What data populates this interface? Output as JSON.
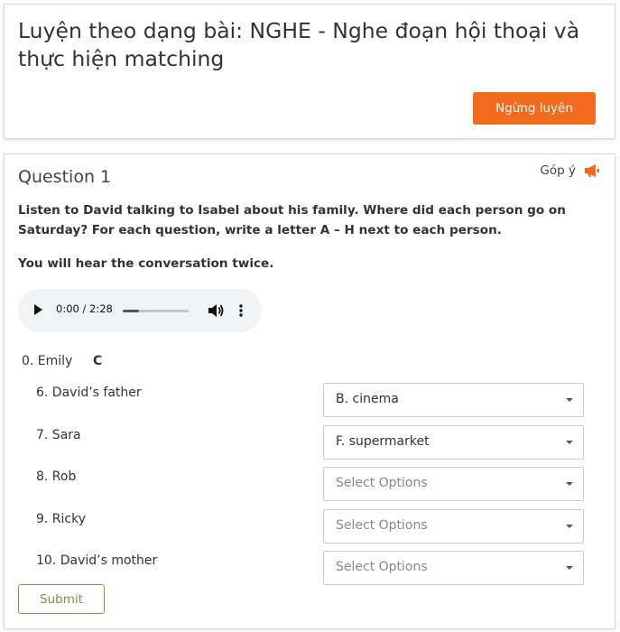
{
  "header": {
    "title": "Luyện theo dạng bài: NGHE - Nghe đoạn hội thoại và thực hiện matching",
    "stop_label": "Ngừng luyện"
  },
  "question": {
    "title": "Question 1",
    "feedback_label": "Góp ý",
    "instruction": "Listen to David talking to Isabel about his family. Where did each person go on Saturday? For each question, write a letter A – H next to each person.",
    "instruction2": "You will hear the conversation twice.",
    "audio": {
      "time": "0:00 / 2:28",
      "progress": 0.0
    },
    "example": {
      "label": "0. Emily",
      "answer": "C"
    },
    "items": [
      {
        "label": "6. David’s father",
        "value": "B. cinema",
        "placeholder": false
      },
      {
        "label": "7. Sara",
        "value": "F. supermarket",
        "placeholder": false
      },
      {
        "label": "8. Rob",
        "value": "Select Options",
        "placeholder": true
      },
      {
        "label": "9. Ricky",
        "value": "Select Options",
        "placeholder": true
      },
      {
        "label": "10. David’s mother",
        "value": "Select Options",
        "placeholder": true
      }
    ],
    "submit_label": "Submit"
  },
  "colors": {
    "accent": "#f26b1d",
    "submit": "#77a14a"
  },
  "icons": {
    "feedback": "megaphone-icon",
    "play": "play-icon",
    "volume": "volume-icon",
    "more": "more-vertical-icon",
    "dropdown": "caret-down-icon"
  }
}
